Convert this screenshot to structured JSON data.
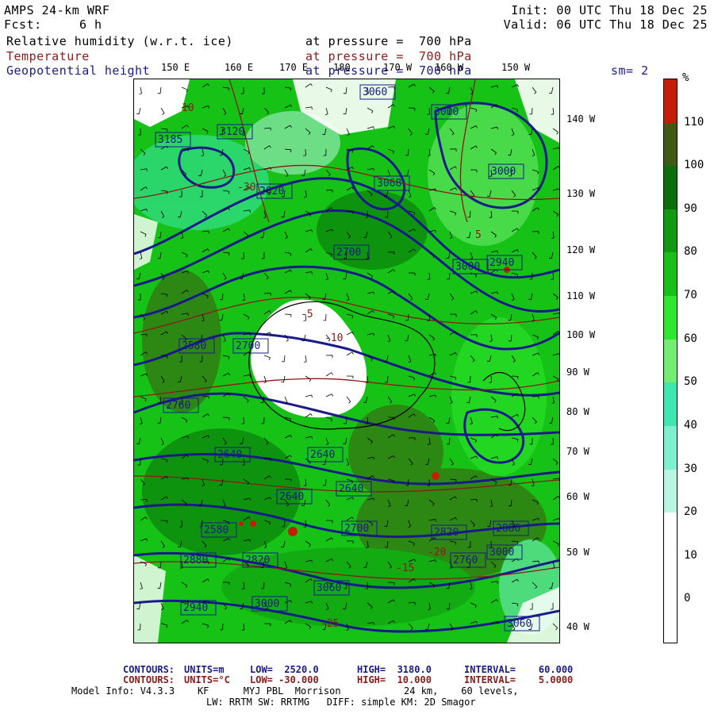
{
  "header": {
    "model": "AMPS 24-km WRF",
    "fcst_label": "Fcst:",
    "fcst_value": "6 h",
    "init": "Init: 00 UTC Thu 18 Dec 25",
    "valid": "Valid: 06 UTC Thu 18 Dec 25"
  },
  "fields": [
    {
      "name": "Relative humidity (w.r.t. ice)",
      "level": "at pressure =  700 hPa",
      "color": "#000000"
    },
    {
      "name": "Temperature",
      "level": "at pressure =  700 hPa",
      "color": "#8b1a1a"
    },
    {
      "name": "Geopotential height",
      "level": "at pressure =  700 hPa",
      "color": "#1a1a8b"
    }
  ],
  "smoothing": "sm= 2",
  "map": {
    "top_labels": [
      "150 E",
      "160 E",
      "170 E",
      "180",
      "170 W",
      "160 W",
      "150 W"
    ],
    "right_labels": [
      "140 W",
      "130 W",
      "120 W",
      "110 W",
      "100 W",
      "90 W",
      "80 W",
      "70 W",
      "60 W",
      "50 W",
      "40 W"
    ],
    "height_contour_labels": [
      "3060",
      "3000",
      "3120",
      "3185",
      "3068",
      "3000",
      "2820",
      "2700",
      "2640",
      "2580",
      "2700",
      "2760",
      "2640",
      "2640",
      "2580",
      "2640",
      "2700",
      "2820",
      "2880",
      "2940",
      "3000",
      "3060",
      "2880",
      "2820",
      "2760",
      "3000",
      "3060",
      "2940",
      "3000"
    ],
    "temperature_contour_labels": [
      "-5",
      "-10",
      "-15",
      "-20",
      "-25",
      "-30",
      "5",
      "10"
    ]
  },
  "colorbar": {
    "unit": "%",
    "levels": [
      "110",
      "100",
      "90",
      "80",
      "70",
      "60",
      "50",
      "40",
      "30",
      "20",
      "10",
      "0"
    ],
    "colors": [
      "#c41e0a",
      "#3f5a12",
      "#0a6e0a",
      "#109a10",
      "#15c215",
      "#2ee82e",
      "#73ee73",
      "#3de8b0",
      "#7df0d0",
      "#b8f5e3",
      "#ffffff",
      "#ffffff",
      "#ffffff"
    ]
  },
  "footer": {
    "line1": {
      "label": "CONTOURS:",
      "units": "UNITS=m",
      "low": "LOW=  2520.0",
      "high": "HIGH=  3180.0",
      "interval": "INTERVAL=    60.000"
    },
    "line2": {
      "label": "CONTOURS:",
      "units": "UNITS=°C",
      "low": "LOW= -30.000",
      "high": "HIGH=  10.000",
      "interval": "INTERVAL=    5.0000"
    },
    "line3": "Model Info: V4.3.3    KF      MYJ PBL  Morrison           24 km,    60 levels,",
    "line4": "LW: RRTM SW: RRTMG   DIFF: simple KM: 2D Smagor"
  }
}
